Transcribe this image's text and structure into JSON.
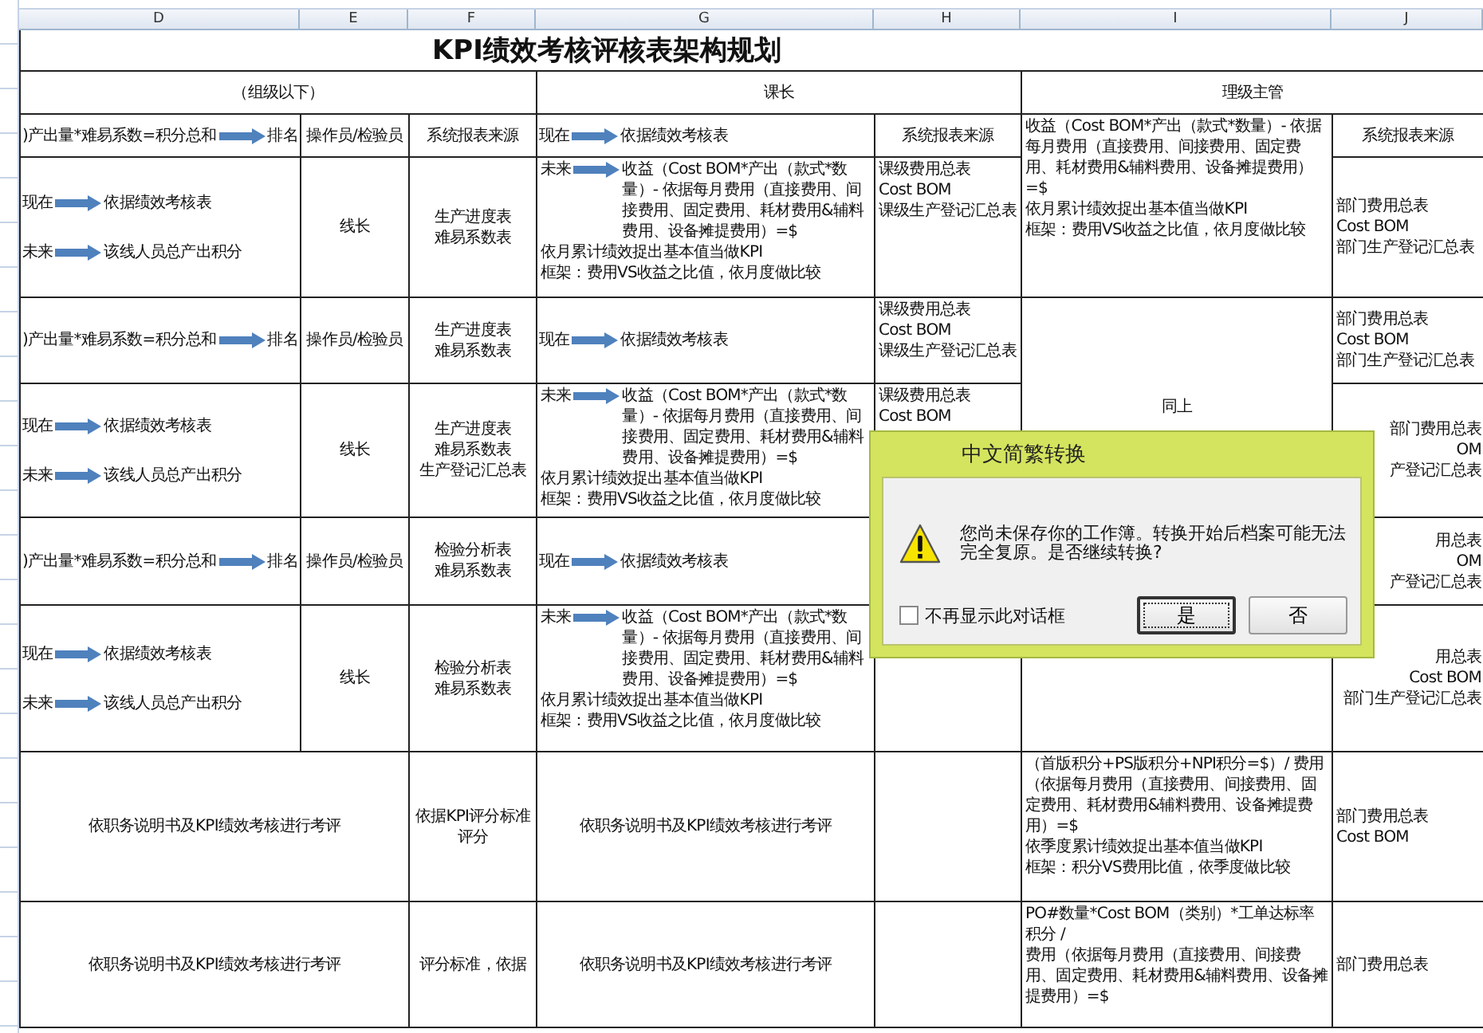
{
  "columns": [
    "D",
    "E",
    "F",
    "G",
    "H",
    "I",
    "J"
  ],
  "title": "KPI绩效考核评核表架构规划",
  "groups": [
    "（组级以下）",
    "课长",
    "理级主管"
  ],
  "rows": [
    {
      "cells": [
        {
          "kind": "flow",
          "arrows": [
            {
              "before": ")产出量*难易系数=积分总和",
              "after": "排名"
            }
          ]
        },
        {
          "kind": "label",
          "lines": [
            "操作员/检验员"
          ]
        },
        {
          "kind": "label",
          "lines": [
            "系统报表来源"
          ]
        },
        {
          "kind": "flow",
          "arrows": [
            {
              "before": "现在",
              "after": "依据绩效考核表"
            }
          ]
        },
        {
          "kind": "label",
          "lines": [
            "系统报表来源"
          ]
        },
        {
          "kind": "formula",
          "lines": [
            "收益（Cost BOM*产出（款式*数量）- 依据每月费用（直接费用、间接费用、固定费用、耗材费用&辅料费用、设备摊提费用）=$",
            "依月累计绩效捉出基本值当做KPI",
            "框架：费用VS收益之比值，依月度做比较"
          ]
        },
        {
          "kind": "label",
          "lines": [
            "系统报表来源"
          ]
        }
      ]
    },
    {
      "cells": [
        {
          "kind": "flow",
          "arrows": [
            {
              "before": "现在",
              "after": "依据绩效考核表"
            },
            {
              "before": "未来",
              "after": "该线人员总产出积分"
            }
          ]
        },
        {
          "kind": "label",
          "lines": [
            "线长"
          ]
        },
        {
          "kind": "label",
          "lines": [
            "生产进度表",
            "难易系数表"
          ]
        },
        {
          "kind": "formula",
          "arrows": [
            {
              "before": "未来",
              "after": "收益（Cost BOM*产出（款式*数量）- 依据每月费用（直接费用、间接费用、固定费用、耗材费用&辅料费用、设备摊提费用）=$"
            }
          ],
          "lines": [
            "依月累计绩效捉出基本值当做KPI",
            "框架：费用VS收益之比值，依月度做比较"
          ]
        },
        {
          "kind": "formula",
          "lines": [
            "课级费用总表",
            "Cost BOM",
            "课级生产登记汇总表"
          ]
        },
        {
          "kind": "list",
          "lines": [
            "部门费用总表",
            "Cost BOM",
            "部门生产登记汇总表"
          ]
        }
      ]
    },
    {
      "cells": [
        {
          "kind": "flow",
          "arrows": [
            {
              "before": ")产出量*难易系数=积分总和",
              "after": "排名"
            }
          ]
        },
        {
          "kind": "label",
          "lines": [
            "操作员/检验员"
          ]
        },
        {
          "kind": "label",
          "lines": [
            "生产进度表",
            "难易系数表"
          ]
        },
        {
          "kind": "flow",
          "arrows": [
            {
              "before": "现在",
              "after": "依据绩效考核表"
            }
          ]
        },
        {
          "kind": "formula",
          "lines": [
            "课级费用总表",
            "Cost BOM",
            "课级生产登记汇总表"
          ]
        },
        {
          "kind": "label",
          "lines": [
            "同上"
          ]
        },
        {
          "kind": "list",
          "lines": [
            "部门费用总表",
            "Cost BOM",
            "部门生产登记汇总表"
          ]
        }
      ]
    },
    {
      "cells": [
        {
          "kind": "flow",
          "arrows": [
            {
              "before": "现在",
              "after": "依据绩效考核表"
            },
            {
              "before": "未来",
              "after": "该线人员总产出积分"
            }
          ]
        },
        {
          "kind": "label",
          "lines": [
            "线长"
          ]
        },
        {
          "kind": "label",
          "lines": [
            "生产进度表",
            "难易系数表",
            "生产登记汇总表"
          ]
        },
        {
          "kind": "formula",
          "arrows": [
            {
              "before": "未来",
              "after": "收益（Cost BOM*产出（款式*数量）- 依据每月费用（直接费用、间接费用、固定费用、耗材费用&辅料费用、设备摊提费用）=$"
            }
          ],
          "lines": [
            "依月累计绩效捉出基本值当做KPI",
            "框架：费用VS收益之比值，依月度做比较"
          ]
        },
        {
          "kind": "formula",
          "lines": [
            "课级费用总表",
            "Cost BOM"
          ]
        },
        {
          "kind": "clipped",
          "lines": [
            "部门费用总表",
            "OM",
            "产登记汇总表"
          ]
        }
      ]
    },
    {
      "cells": [
        {
          "kind": "flow",
          "arrows": [
            {
              "before": ")产出量*难易系数=积分总和",
              "after": "排名"
            }
          ]
        },
        {
          "kind": "label",
          "lines": [
            "操作员/检验员"
          ]
        },
        {
          "kind": "label",
          "lines": [
            "检验分析表",
            "难易系数表"
          ]
        },
        {
          "kind": "flow",
          "arrows": [
            {
              "before": "现在",
              "after": "依据绩效考核表"
            }
          ]
        },
        {
          "kind": "blank"
        },
        {
          "kind": "clipped",
          "lines": [
            "用总表",
            "OM",
            "产登记汇总表"
          ]
        }
      ]
    },
    {
      "cells": [
        {
          "kind": "flow",
          "arrows": [
            {
              "before": "现在",
              "after": "依据绩效考核表"
            },
            {
              "before": "未来",
              "after": "该线人员总产出积分"
            }
          ]
        },
        {
          "kind": "label",
          "lines": [
            "线长"
          ]
        },
        {
          "kind": "label",
          "lines": [
            "检验分析表",
            "难易系数表"
          ]
        },
        {
          "kind": "formula",
          "arrows": [
            {
              "before": "未来",
              "after": "收益（Cost BOM*产出（款式*数量）- 依据每月费用（直接费用、间接费用、固定费用、耗材费用&辅料费用、设备摊提费用）=$"
            }
          ],
          "lines": [
            "依月累计绩效捉出基本值当做KPI",
            "框架：费用VS收益之比值，依月度做比较"
          ]
        },
        {
          "kind": "blank"
        },
        {
          "kind": "clipped",
          "lines": [
            "用总表",
            "Cost BOM",
            "部门生产登记汇总表"
          ]
        }
      ]
    },
    {
      "cells": [
        {
          "kind": "label",
          "lines": [
            "依职务说明书及KPI绩效考核进行考评"
          ]
        },
        {
          "kind": "label",
          "lines": [
            "依据KPI评分标准",
            "评分"
          ]
        },
        {
          "kind": "label",
          "lines": [
            "依职务说明书及KPI绩效考核进行考评"
          ]
        },
        {
          "kind": "blank"
        },
        {
          "kind": "formula",
          "lines": [
            "（首版积分+PS版积分+NPI积分=$）/ 费用（依据每月费用（直接费用、间接费用、固定费用、耗材费用&辅料费用、设备摊提费用）=$",
            "依季度累计绩效捉出基本值当做KPI",
            "框架：积分VS费用比值，依季度做比较"
          ]
        },
        {
          "kind": "list",
          "lines": [
            "部门费用总表",
            "Cost BOM"
          ]
        }
      ]
    },
    {
      "cells": [
        {
          "kind": "label",
          "lines": [
            "依职务说明书及KPI绩效考核进行考评"
          ]
        },
        {
          "kind": "label",
          "lines": [
            "评分标准，依据"
          ]
        },
        {
          "kind": "label",
          "lines": [
            "依职务说明书及KPI绩效考核进行考评"
          ]
        },
        {
          "kind": "blank"
        },
        {
          "kind": "formula",
          "lines": [
            "PO#数量*Cost BOM（类别）*工单达标率积分 /",
            "费用（依据每月费用（直接费用、间接费用、固定费用、耗材费用&辅料费用、设备摊提费用）=$"
          ]
        },
        {
          "kind": "list",
          "lines": [
            "部门费用总表"
          ]
        }
      ]
    }
  ],
  "dialog": {
    "title": "中文简繁转换",
    "message": "您尚未保存你的工作簿。转换开始后档案可能无法完全复原。是否继续转换?",
    "checkbox": {
      "label": "不再显示此对话框",
      "checked": false
    },
    "buttons": [
      {
        "label": "是",
        "focused": true
      },
      {
        "label": "否",
        "focused": false
      }
    ]
  }
}
